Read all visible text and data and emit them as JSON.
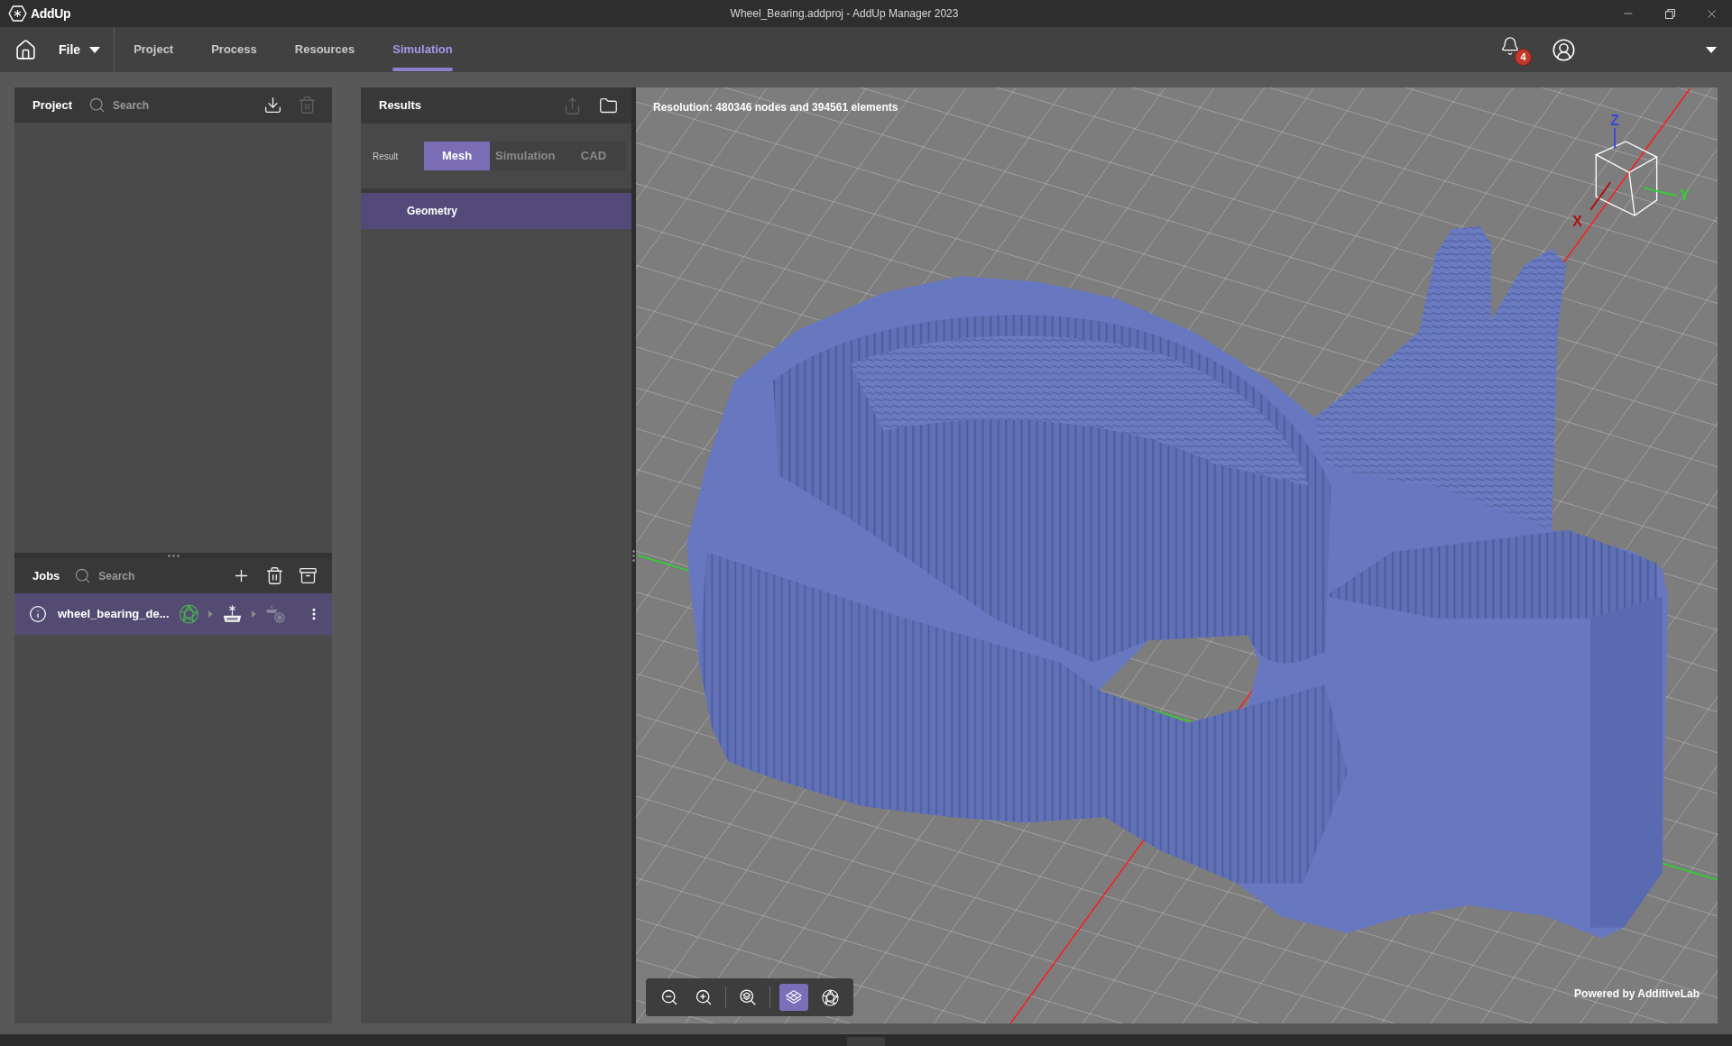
{
  "window": {
    "logo": "AddUp",
    "title": "Wheel_Bearing.addproj - AddUp Manager 2023"
  },
  "menu": {
    "file": "File",
    "tabs": [
      {
        "label": "Project",
        "selected": false
      },
      {
        "label": "Process",
        "selected": false
      },
      {
        "label": "Resources",
        "selected": false
      },
      {
        "label": "Simulation",
        "selected": true
      }
    ],
    "notifications": "4"
  },
  "project_panel": {
    "title": "Project",
    "search": {
      "placeholder": "Search"
    },
    "actions": [
      {
        "kind": "download",
        "disabled": false
      },
      {
        "kind": "delete",
        "disabled": true
      }
    ]
  },
  "jobs_panel": {
    "title": "Jobs",
    "search": {
      "placeholder": "Search"
    },
    "actions": [
      {
        "kind": "add",
        "disabled": false
      },
      {
        "kind": "delete",
        "disabled": false
      },
      {
        "kind": "archive",
        "disabled": false
      }
    ],
    "jobs": [
      {
        "name": "wheel_bearing_de...",
        "selected": true,
        "steps": [
          {
            "kind": "mesh",
            "completed": true,
            "disabled": false
          },
          {
            "kind": "build",
            "completed": false,
            "disabled": false
          },
          {
            "kind": "simulation",
            "completed": false,
            "disabled": true
          }
        ]
      }
    ]
  },
  "results_panel": {
    "title": "Results",
    "actions": [
      {
        "kind": "export",
        "disabled": true
      },
      {
        "kind": "folder",
        "disabled": false
      }
    ],
    "result_label": "Result",
    "modes": [
      {
        "label": "Mesh",
        "selected": true
      },
      {
        "label": "Simulation",
        "selected": false
      },
      {
        "label": "CAD",
        "selected": false
      }
    ],
    "items": [
      {
        "label": "Geometry",
        "selected": true
      }
    ]
  },
  "viewport": {
    "resolution": "Resolution: 480346 nodes and 394561 elements",
    "axes": [
      {
        "label": "Z",
        "color": "#3a46e0"
      },
      {
        "label": "X",
        "color": "#b01010"
      },
      {
        "label": "Y",
        "color": "#30d030"
      }
    ],
    "tool_groups": [
      {
        "tools": [
          {
            "kind": "zoom-out",
            "selected": false
          },
          {
            "kind": "zoom-in",
            "selected": false
          }
        ]
      },
      {
        "tools": [
          {
            "kind": "zoom-fit",
            "selected": false
          }
        ]
      },
      {
        "tools": [
          {
            "kind": "mesh-view",
            "selected": true
          },
          {
            "kind": "sphere-view",
            "selected": false
          }
        ]
      }
    ],
    "credit": "Powered by AdditiveLab"
  }
}
